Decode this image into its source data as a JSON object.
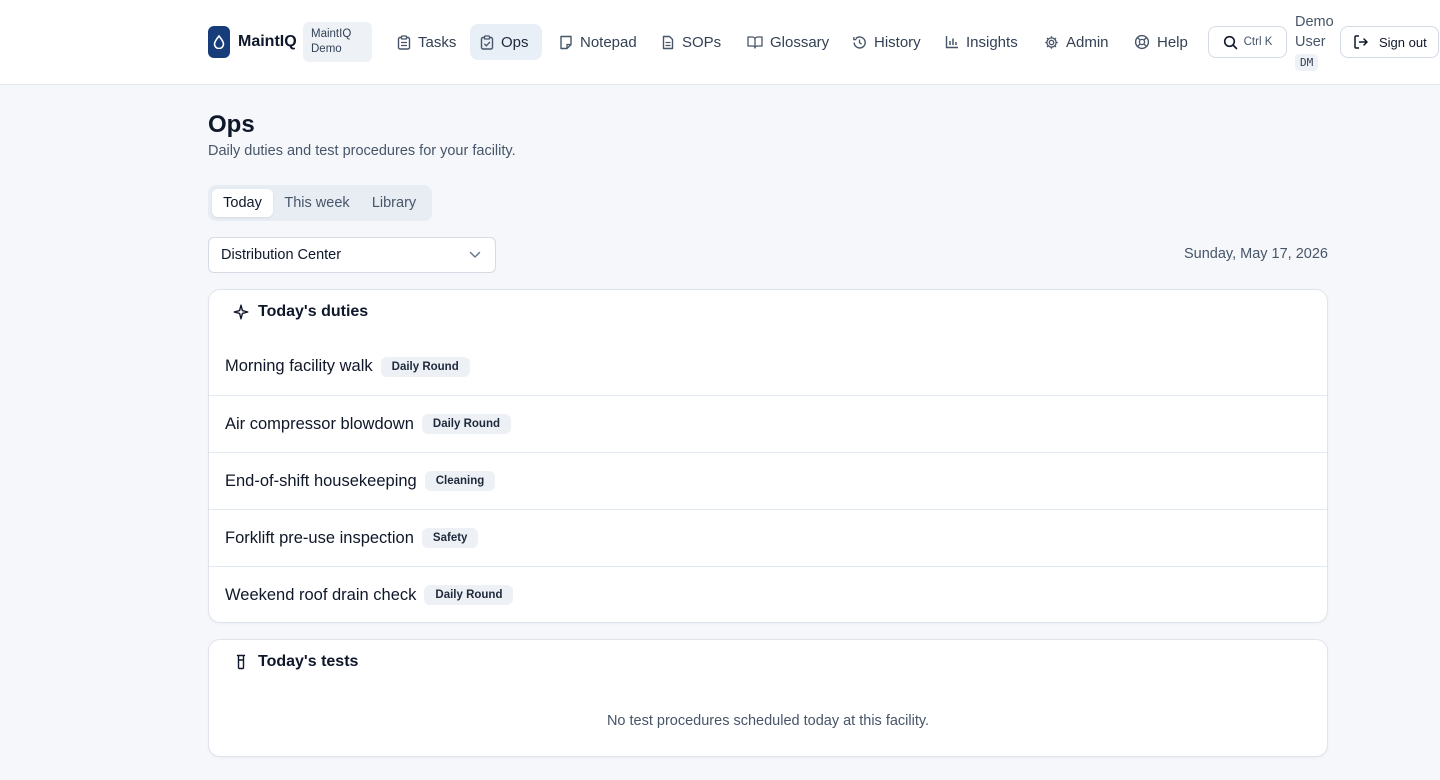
{
  "brand": {
    "name": "MaintIQ",
    "org_line1": "MaintIQ",
    "org_line2": "Demo"
  },
  "nav": {
    "items": [
      {
        "label": "Tasks",
        "icon": "clipboard-icon"
      },
      {
        "label": "Ops",
        "icon": "clipboard-check-icon",
        "active": true
      },
      {
        "label": "Notepad",
        "icon": "sticky-note-icon"
      },
      {
        "label": "SOPs",
        "icon": "file-text-icon"
      },
      {
        "label": "Glossary",
        "icon": "book-open-icon"
      },
      {
        "label": "History",
        "icon": "history-icon"
      },
      {
        "label": "Insights",
        "icon": "bar-chart-icon"
      },
      {
        "label": "Admin",
        "icon": "gear-icon"
      },
      {
        "label": "Help",
        "icon": "life-buoy-icon"
      }
    ],
    "search_shortcut": "Ctrl K",
    "user_line1": "Demo",
    "user_line2": "User",
    "user_initials": "DM",
    "signout_label": "Sign out"
  },
  "page": {
    "title": "Ops",
    "subtitle": "Daily duties and test procedures for your facility."
  },
  "tabs": [
    {
      "label": "Today",
      "active": true
    },
    {
      "label": "This week"
    },
    {
      "label": "Library"
    }
  ],
  "facility_select": {
    "value": "Distribution Center"
  },
  "date": "Sunday, May 17, 2026",
  "duties": {
    "title": "Today's duties",
    "items": [
      {
        "name": "Morning facility walk",
        "tag": "Daily Round"
      },
      {
        "name": "Air compressor blowdown",
        "tag": "Daily Round"
      },
      {
        "name": "End-of-shift housekeeping",
        "tag": "Cleaning"
      },
      {
        "name": "Forklift pre-use inspection",
        "tag": "Safety"
      },
      {
        "name": "Weekend roof drain check",
        "tag": "Daily Round"
      }
    ]
  },
  "tests": {
    "title": "Today's tests",
    "empty_message": "No test procedures scheduled today at this facility."
  },
  "colors": {
    "brand": "#163d7a",
    "background": "#f5f7fb",
    "active_nav": "#e9eff7"
  }
}
